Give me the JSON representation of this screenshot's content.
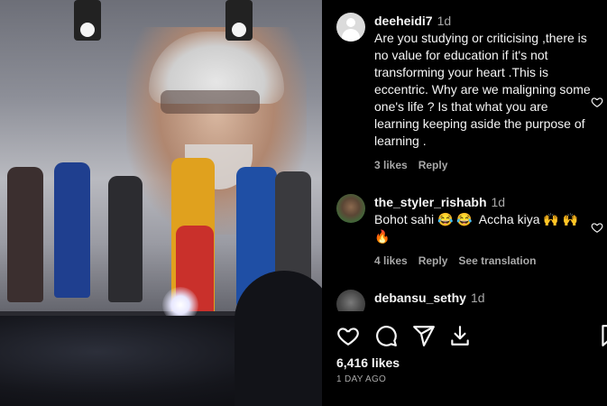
{
  "comments": [
    {
      "username": "deeheidi7",
      "time": "1d",
      "text": "Are you studying or criticising ,there is no value for education if it's not transforming your heart .This is eccentric. Why are we maligning some one's life ? Is that what you are learning keeping aside the purpose of learning .",
      "likes": "3 likes",
      "reply": "Reply"
    },
    {
      "username": "the_styler_rishabh",
      "time": "1d",
      "text": "Bohot sahi 😂 😂  Accha kiya 🙌 🙌 🔥",
      "likes": "4 likes",
      "reply": "Reply",
      "see_translation": "See translation"
    },
    {
      "username": "debansu_sethy",
      "time": "1d"
    }
  ],
  "post": {
    "likes": "6,416 likes",
    "date": "1 DAY AGO"
  },
  "colors": {
    "background": "#000000",
    "text": "#f5f5f5",
    "muted": "#a8a8a8"
  },
  "icons": [
    "heart-icon",
    "comment-icon",
    "share-icon",
    "download-icon",
    "bookmark-icon"
  ]
}
